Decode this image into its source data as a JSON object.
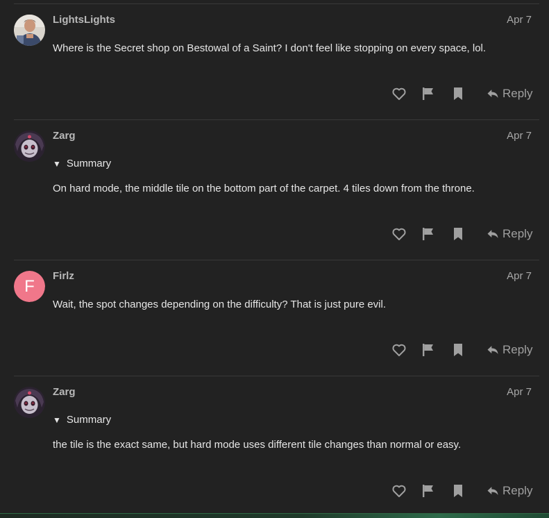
{
  "posts": [
    {
      "username": "LightsLights",
      "date": "Apr 7",
      "avatar": {
        "kind": "photo",
        "icon": "user-photo"
      },
      "summary": null,
      "body": "Where is the Secret shop on Bestowal of a Saint? I don't feel like stopping on every space, lol.",
      "reply_label": "Reply"
    },
    {
      "username": "Zarg",
      "date": "Apr 7",
      "avatar": {
        "kind": "photo",
        "icon": "character-face"
      },
      "summary": "Summary",
      "body": "On hard mode, the middle tile on the bottom part of the carpet. 4 tiles down from the throne.",
      "reply_label": "Reply"
    },
    {
      "username": "Firlz",
      "date": "Apr 7",
      "avatar": {
        "kind": "letter",
        "letter": "F",
        "color": "#f0778a"
      },
      "summary": null,
      "body": "Wait, the spot changes depending on the difficulty? That is just pure evil.",
      "reply_label": "Reply"
    },
    {
      "username": "Zarg",
      "date": "Apr 7",
      "avatar": {
        "kind": "photo",
        "icon": "character-face"
      },
      "summary": "Summary",
      "body": "the tile is the exact same, but hard mode uses different tile changes than normal or easy.",
      "reply_label": "Reply"
    }
  ],
  "icons": {
    "like": "heart-icon",
    "flag": "flag-icon",
    "bookmark": "bookmark-icon",
    "reply": "reply-arrow-icon"
  },
  "colors": {
    "background": "#222222",
    "text": "#e6e6e6",
    "muted": "#a0a0a0",
    "divider": "#3a3a3a"
  }
}
